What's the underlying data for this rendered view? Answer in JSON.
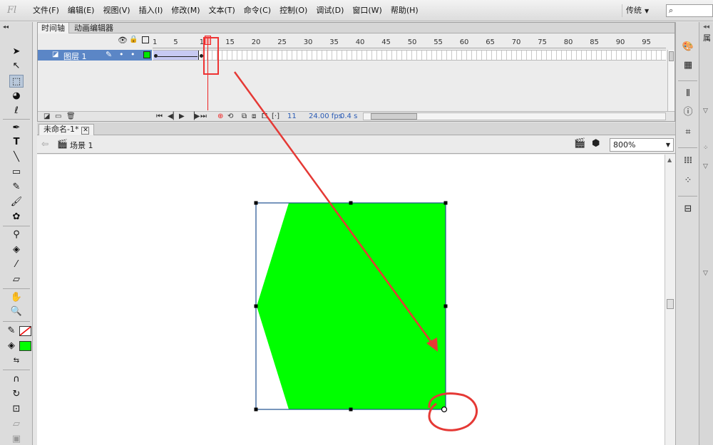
{
  "app": {
    "logo": "Fl"
  },
  "menu": [
    "文件(F)",
    "编辑(E)",
    "视图(V)",
    "插入(I)",
    "修改(M)",
    "文本(T)",
    "命令(C)",
    "控制(O)",
    "调试(D)",
    "窗口(W)",
    "帮助(H)"
  ],
  "workspace": "传统",
  "timeline": {
    "tabs": [
      "时间轴",
      "动画编辑器"
    ],
    "layer_name": "图层 1",
    "frame_numbers": [
      "1",
      "5",
      "10",
      "15",
      "20",
      "25",
      "30",
      "35",
      "40",
      "45",
      "50",
      "55",
      "60",
      "65",
      "70",
      "75",
      "80",
      "85",
      "90",
      "95"
    ],
    "current_frame": "11",
    "fps": "24.00 fps",
    "time": "0.4 s"
  },
  "document": {
    "tab_name": "未命名-1*",
    "scene": "场景 1",
    "zoom": "800%"
  },
  "colors": {
    "fill": "#00ff00",
    "stroke": "none",
    "annotation": "#e53935",
    "selection": "#1f4f8f",
    "layer_row": "#5b86c6"
  },
  "icons": [
    "selection-tool-icon",
    "subselection-tool-icon",
    "free-transform-tool-icon",
    "3d-rotation-tool-icon",
    "lasso-tool-icon",
    "pen-tool-icon",
    "text-tool-icon",
    "line-tool-icon",
    "rectangle-tool-icon",
    "pencil-tool-icon",
    "brush-tool-icon",
    "deco-tool-icon",
    "bone-tool-icon",
    "paint-bucket-tool-icon",
    "eyedropper-tool-icon",
    "eraser-tool-icon",
    "hand-tool-icon",
    "zoom-tool-icon"
  ]
}
